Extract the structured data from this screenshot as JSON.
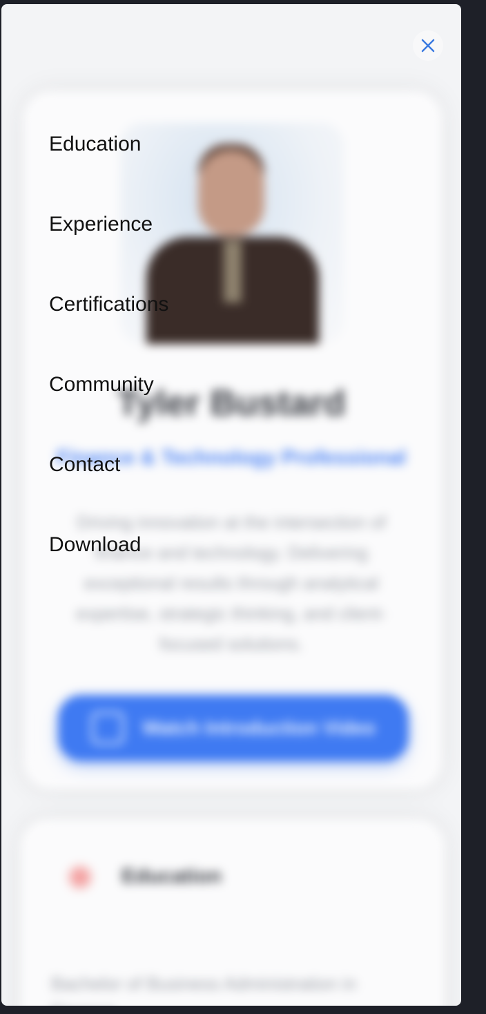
{
  "profile": {
    "name": "Tyler Bustard",
    "role": "Finance & Technology Professional",
    "bio": "Driving innovation at the intersection of finance and technology. Delivering exceptional results through analytical expertise, strategic thinking, and client-focused solutions.",
    "video_button_label": "Watch Introduction Video"
  },
  "education_section": {
    "heading": "Education",
    "degree": "Bachelor of Business Administration in Finance"
  },
  "menu": {
    "items": [
      "Education",
      "Experience",
      "Certifications",
      "Community",
      "Contact",
      "Download"
    ],
    "close_icon": "close-icon"
  },
  "colors": {
    "accent": "#3f7af2",
    "close": "#3b7ae0",
    "background": "#1e2028",
    "panel": "#f3f4f6"
  }
}
